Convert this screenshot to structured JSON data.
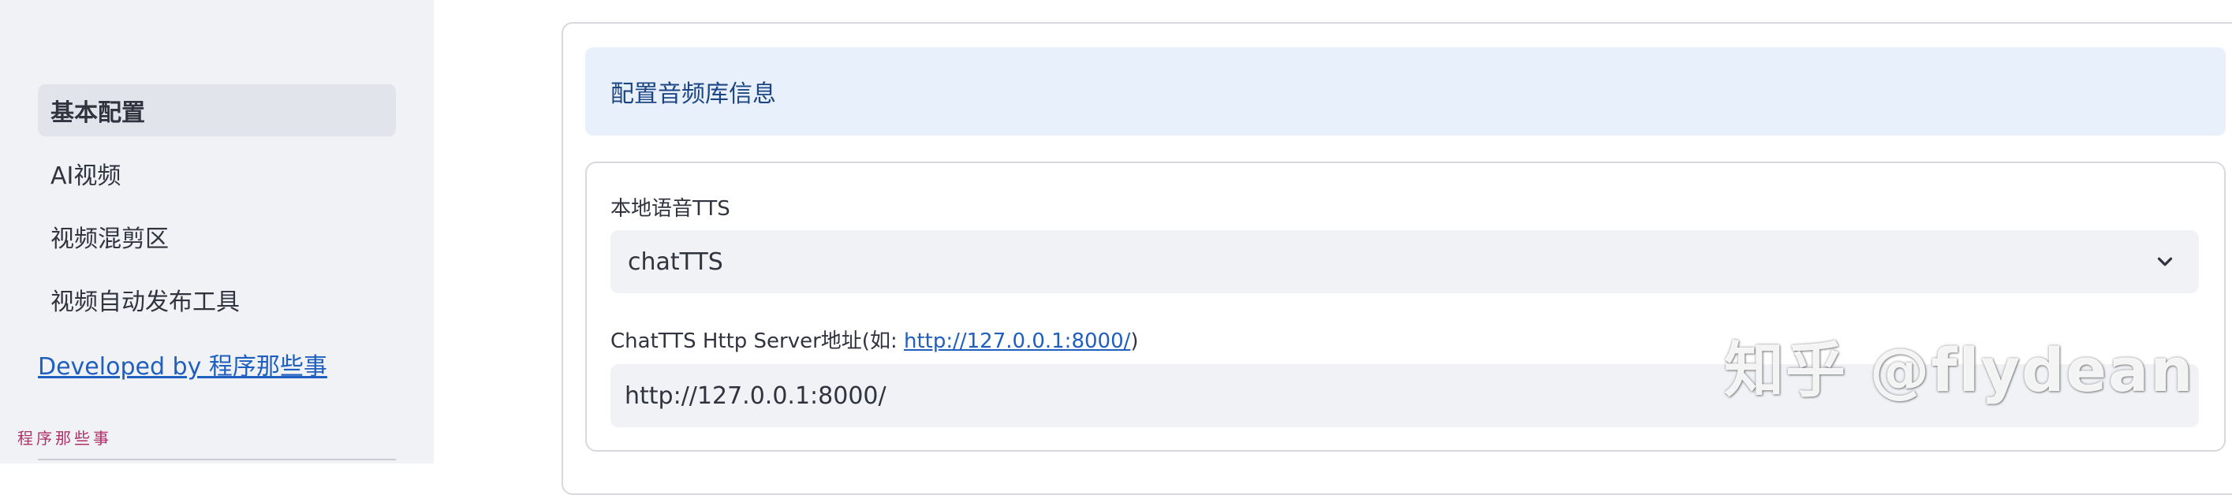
{
  "sidebar": {
    "items": [
      {
        "label": "基本配置",
        "active": true
      },
      {
        "label": "AI视频",
        "active": false
      },
      {
        "label": "视频混剪区",
        "active": false
      },
      {
        "label": "视频自动发布工具",
        "active": false
      }
    ],
    "developed_link": "Developed by 程序那些事",
    "logo_text": "程序那些事"
  },
  "main": {
    "info_title": "配置音频库信息",
    "tts_label": "本地语音TTS",
    "tts_selected": "chatTTS",
    "server_label_prefix": "ChatTTS Http Server地址(如: ",
    "server_label_link": "http://127.0.0.1:8000/",
    "server_label_suffix": ")",
    "server_value": "http://127.0.0.1:8000/"
  },
  "watermark": "知乎 @flydean",
  "colors": {
    "sidebar_bg": "#f0f2f6",
    "info_bg": "#e8f0fc",
    "info_text": "#1c4583",
    "link": "#1f5fbf"
  }
}
